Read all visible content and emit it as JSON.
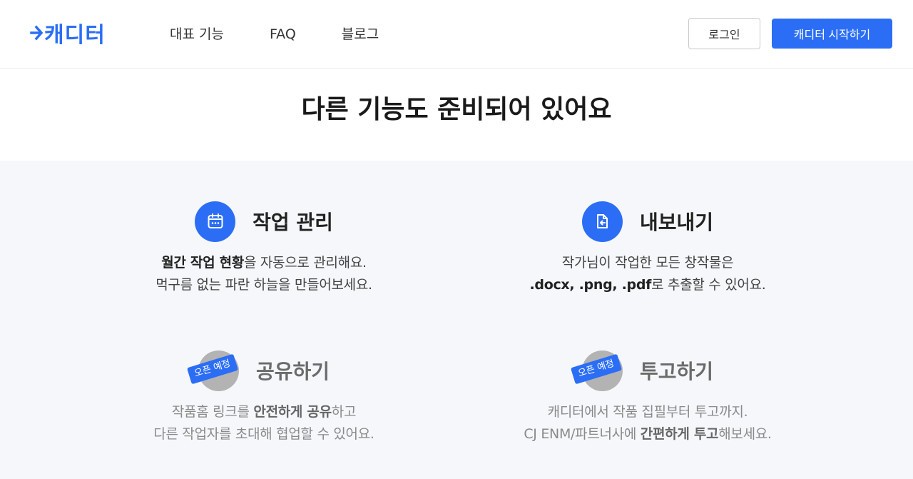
{
  "header": {
    "logo": "캐디터",
    "nav": [
      "대표 기능",
      "FAQ",
      "블로그"
    ],
    "login_label": "로그인",
    "start_label": "캐디터 시작하기"
  },
  "section": {
    "title": "다른 기능도 준비되어 있어요"
  },
  "features": [
    {
      "title": "작업 관리",
      "icon": "calendar-icon",
      "line1_bold": "월간 작업 현황",
      "line1_rest": "을 자동으로 관리해요.",
      "line2": "먹구름 없는 파란 하늘을 만들어보세요."
    },
    {
      "title": "내보내기",
      "icon": "file-export-icon",
      "line1": "작가님이 작업한 모든 창작물은",
      "line2_bold": ".docx, .png, .pdf",
      "line2_rest": "로 추출할 수 있어요."
    },
    {
      "title": "공유하기",
      "badge": "오픈 예정",
      "line1_pre": "작품홈 링크를 ",
      "line1_bold": "안전하게 공유",
      "line1_rest": "하고",
      "line2": "다른 작업자를 초대해 협업할 수 있어요."
    },
    {
      "title": "투고하기",
      "badge": "오픈 예정",
      "line1": "캐디터에서 작품 집필부터 투고까지.",
      "line2_pre": "CJ ENM/파트너사에 ",
      "line2_bold": "간편하게 투고",
      "line2_rest": "해보세요."
    }
  ],
  "colors": {
    "accent": "#2b6ef5",
    "features_bg": "#f5f7fa"
  }
}
